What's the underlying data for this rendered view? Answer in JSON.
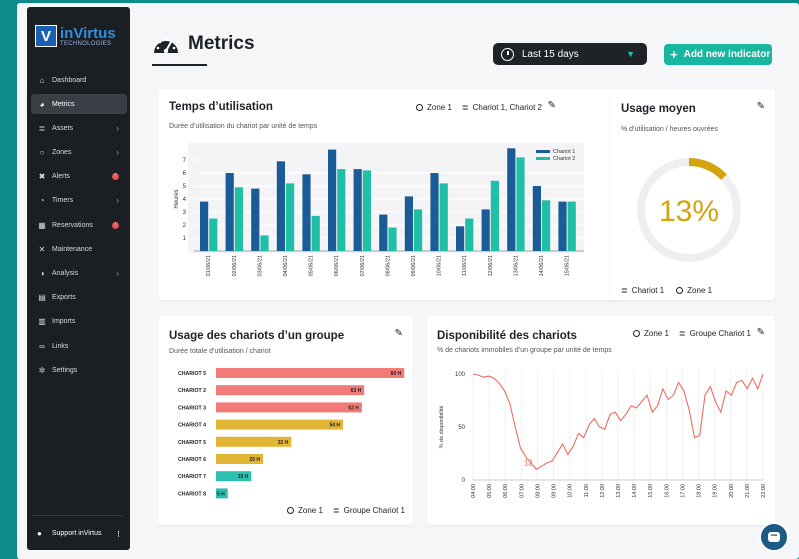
{
  "sidebar": {
    "logo_main": "inVirtus",
    "logo_sub": "TECHNOLOGIES",
    "logo_letter": "V",
    "items": [
      {
        "label": "Dashboard",
        "icon": "home-icon",
        "glyph": "⌂",
        "chevron": false,
        "badge": false,
        "active": false
      },
      {
        "label": "Metrics",
        "icon": "speedometer-icon",
        "glyph": "◕",
        "chevron": false,
        "badge": false,
        "active": true
      },
      {
        "label": "Assets",
        "icon": "database-icon",
        "glyph": "≣",
        "chevron": true,
        "badge": false,
        "active": false
      },
      {
        "label": "Zones",
        "icon": "circle-icon",
        "glyph": "○",
        "chevron": true,
        "badge": false,
        "active": false
      },
      {
        "label": "Alerts",
        "icon": "wrench-icon",
        "glyph": "✖",
        "chevron": false,
        "badge": true,
        "active": false
      },
      {
        "label": "Timers",
        "icon": "stopwatch-icon",
        "glyph": "◔",
        "chevron": true,
        "badge": false,
        "active": false
      },
      {
        "label": "Reservations",
        "icon": "calendar-icon",
        "glyph": "▦",
        "chevron": false,
        "badge": true,
        "active": false
      },
      {
        "label": "Maintenance",
        "icon": "tools-icon",
        "glyph": "✕",
        "chevron": false,
        "badge": false,
        "active": false
      },
      {
        "label": "Analysis",
        "icon": "pie-chart-icon",
        "glyph": "◑",
        "chevron": true,
        "badge": false,
        "active": false
      },
      {
        "label": "Exports",
        "icon": "file-export-icon",
        "glyph": "▤",
        "chevron": false,
        "badge": false,
        "active": false
      },
      {
        "label": "Imports",
        "icon": "file-import-icon",
        "glyph": "▥",
        "chevron": false,
        "badge": false,
        "active": false
      },
      {
        "label": "Links",
        "icon": "link-icon",
        "glyph": "∞",
        "chevron": false,
        "badge": false,
        "active": false
      },
      {
        "label": "Settings",
        "icon": "gears-icon",
        "glyph": "✲",
        "chevron": false,
        "badge": false,
        "active": false
      }
    ],
    "support_label": "Support inVirtus",
    "support_dots": "⋮"
  },
  "header": {
    "title": "Metrics",
    "date_range": "Last 15 days",
    "add_button": "Add new indicator"
  },
  "colors": {
    "bar_blue": "#1b5b96",
    "bar_teal": "#1fbfa6",
    "accent": "#16b6a0",
    "gauge": "#d4a40c",
    "line": "#f26b5e"
  },
  "card_usage_time": {
    "title": "Temps d’utilisation",
    "subtitle": "Durée d’utilisation du chariot par unité de temps",
    "zone_filter": "Zone 1",
    "asset_filter": "Chariot 1, Chariot 2"
  },
  "card_avg_usage": {
    "title": "Usage moyen",
    "subtitle": "% d’utilisation / heures ouvrées",
    "value_label": "13%",
    "value": 13,
    "asset_filter": "Chariot 1",
    "zone_filter": "Zone 1"
  },
  "card_group_usage": {
    "title": "Usage des chariots d’un groupe",
    "subtitle": "Durée totale d’utilisation / chariot",
    "zone_filter": "Zone 1",
    "group_filter": "Groupe Chariot 1"
  },
  "card_availability": {
    "title": "Disponibilité des chariots",
    "subtitle": "% de chariots immobiles d’un groupe par unité de temps",
    "zone_filter": "Zone 1",
    "group_filter": "Groupe Chariot 1"
  },
  "chart_data": [
    {
      "type": "bar",
      "ylabel": "Heures",
      "ylim": [
        0,
        8
      ],
      "yticks": [
        1,
        2,
        3,
        4,
        5,
        6,
        7
      ],
      "categories": [
        "01/06/21",
        "02/06/21",
        "03/06/21",
        "04/06/21",
        "05/06/21",
        "06/06/21",
        "07/06/21",
        "08/06/21",
        "09/06/21",
        "10/06/21",
        "11/06/21",
        "12/06/21",
        "13/06/21",
        "14/06/21",
        "15/06/21"
      ],
      "series": [
        {
          "name": "Chariot 1",
          "color": "#1b5b96",
          "values": [
            3.8,
            6.0,
            4.8,
            6.9,
            5.9,
            7.8,
            6.3,
            2.8,
            4.2,
            6.0,
            1.9,
            3.2,
            7.9,
            5.0,
            3.8
          ]
        },
        {
          "name": "Chariot 2",
          "color": "#1fbfa6",
          "values": [
            2.5,
            4.9,
            1.2,
            5.2,
            2.7,
            6.3,
            6.2,
            1.8,
            3.2,
            5.2,
            2.5,
            5.4,
            7.2,
            3.9,
            3.8
          ]
        }
      ],
      "legend": "top-right",
      "grid": true
    },
    {
      "type": "bar",
      "orientation": "horizontal",
      "categories": [
        "CHARIOT 5",
        "CHARIOT 2",
        "CHARIOT 3",
        "CHARIOT 4",
        "CHARIOT 5",
        "CHARIOT 6",
        "CHARIOT 7",
        "CHARIOT 8"
      ],
      "values": [
        80,
        63,
        62,
        54,
        32,
        20,
        15,
        5
      ],
      "value_labels": [
        "80 H",
        "63 H",
        "62 H",
        "54 H",
        "32 H",
        "20 H",
        "15 H",
        "5 H"
      ],
      "colors": [
        "#f27b78",
        "#f27b78",
        "#f27b78",
        "#e2b534",
        "#e2b534",
        "#e2b534",
        "#2fbfb0",
        "#2fbfb0"
      ],
      "xlim": [
        0,
        85
      ]
    },
    {
      "type": "line",
      "ylabel": "% de disponibilité",
      "ylim": [
        0,
        100
      ],
      "yticks": [
        0,
        50,
        100
      ],
      "categories": [
        "04:00",
        "05:00",
        "06:00",
        "07:00",
        "08:00",
        "09:00",
        "10:00",
        "11:00",
        "12:00",
        "13:00",
        "14:00",
        "15:00",
        "16:00",
        "17:00",
        "18:00",
        "19:00",
        "20:00",
        "21:00",
        "22:00"
      ],
      "annotation": "12",
      "values": [
        100,
        99,
        97,
        98,
        96,
        91,
        84,
        72,
        50,
        30,
        22,
        16,
        10,
        13,
        16,
        18,
        26,
        34,
        24,
        32,
        44,
        40,
        52,
        58,
        50,
        48,
        62,
        64,
        56,
        62,
        70,
        68,
        74,
        80,
        64,
        70,
        86,
        76,
        80,
        92,
        84,
        66,
        40,
        42,
        80,
        88,
        74,
        64,
        84,
        80,
        92,
        94,
        86,
        96,
        86,
        100
      ],
      "grid": true,
      "color": "#f26b5e"
    }
  ]
}
